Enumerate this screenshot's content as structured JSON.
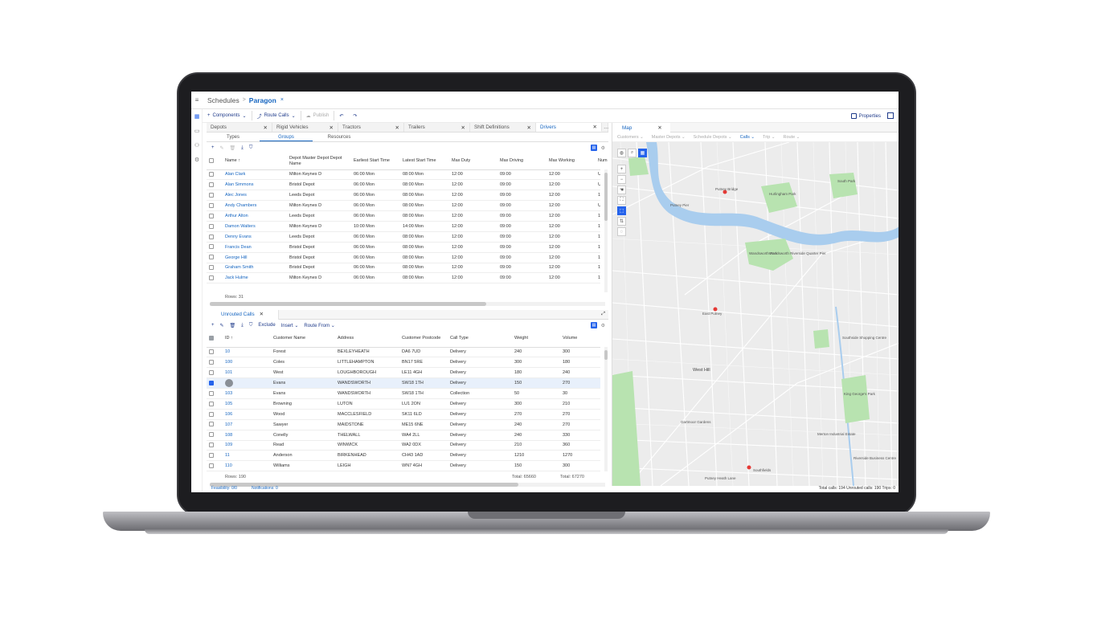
{
  "breadcrumb": {
    "root": "Schedules",
    "sep": ">",
    "current": "Paragon",
    "close": "×"
  },
  "toolbar": {
    "components": "Components",
    "route_calls": "Route Calls",
    "publish": "Publish",
    "properties": "Properties"
  },
  "tabs": [
    {
      "label": "Depots"
    },
    {
      "label": "Rigid Vehicles"
    },
    {
      "label": "Tractors"
    },
    {
      "label": "Trailers"
    },
    {
      "label": "Shift Definitions"
    },
    {
      "label": "Drivers"
    }
  ],
  "subtabs": [
    "Types",
    "Groups",
    "Resources"
  ],
  "drivers": {
    "columns": [
      "Name",
      "Depot Master Depot Depot Name",
      "Earliest Start Time",
      "Latest Start Time",
      "Max Duty",
      "Max Driving",
      "Max Working",
      "Num"
    ],
    "rows": [
      [
        "Alan Clark",
        "Milton Keynes D",
        "06:00 Mon",
        "08:00 Mon",
        "12:00",
        "09:00",
        "12:00",
        "U"
      ],
      [
        "Alan Simmons",
        "Bristol Depot",
        "06:00 Mon",
        "08:00 Mon",
        "12:00",
        "09:00",
        "12:00",
        "U"
      ],
      [
        "Alec Jones",
        "Leeds Depot",
        "06:00 Mon",
        "08:00 Mon",
        "12:00",
        "09:00",
        "12:00",
        "1"
      ],
      [
        "Andy Chambers",
        "Milton Keynes D",
        "06:00 Mon",
        "08:00 Mon",
        "12:00",
        "09:00",
        "12:00",
        "U"
      ],
      [
        "Arthur Alton",
        "Leeds Depot",
        "06:00 Mon",
        "08:00 Mon",
        "12:00",
        "09:00",
        "12:00",
        "1"
      ],
      [
        "Damon Walters",
        "Milton Keynes D",
        "10:00 Mon",
        "14:00 Mon",
        "12:00",
        "09:00",
        "12:00",
        "1"
      ],
      [
        "Denny Evans",
        "Leeds Depot",
        "06:00 Mon",
        "08:00 Mon",
        "12:00",
        "09:00",
        "12:00",
        "1"
      ],
      [
        "Francis Dean",
        "Bristol Depot",
        "06:00 Mon",
        "08:00 Mon",
        "12:00",
        "09:00",
        "12:00",
        "1"
      ],
      [
        "George Hill",
        "Bristol Depot",
        "06:00 Mon",
        "08:00 Mon",
        "12:00",
        "09:00",
        "12:00",
        "1"
      ],
      [
        "Graham Smith",
        "Bristol Depot",
        "06:00 Mon",
        "08:00 Mon",
        "12:00",
        "09:00",
        "12:00",
        "1"
      ],
      [
        "Jack Hulme",
        "Milton Keynes D",
        "06:00 Mon",
        "08:00 Mon",
        "12:00",
        "09:00",
        "12:00",
        "1"
      ]
    ],
    "rows_label": "Rows:  31"
  },
  "calls": {
    "tab": "Unrouted Calls",
    "toolbar": {
      "exclude": "Exclude",
      "insert": "Insert",
      "route_from": "Route From"
    },
    "columns": [
      "ID",
      "Customer Name",
      "Address",
      "Customer Postcode",
      "Call Type",
      "Weight",
      "Volume"
    ],
    "rows": [
      [
        "10",
        "Forest",
        "BEXLEYHEATH",
        "DA6 7UD",
        "Delivery",
        "240",
        "300"
      ],
      [
        "100",
        "Coles",
        "LITTLEHAMPTON",
        "BN17 5RE",
        "Delivery",
        "300",
        "180"
      ],
      [
        "101",
        "West",
        "LOUGHBOROUGH",
        "LE11 4GH",
        "Delivery",
        "180",
        "240"
      ],
      [
        "",
        "Evans",
        "WANDSWORTH",
        "SW18 1TH",
        "Delivery",
        "150",
        "270"
      ],
      [
        "103",
        "Evans",
        "WANDSWORTH",
        "SW18 1TH",
        "Collection",
        "50",
        "30"
      ],
      [
        "105",
        "Browning",
        "LUTON",
        "LU1 2ON",
        "Delivery",
        "300",
        "210"
      ],
      [
        "106",
        "Wood",
        "MACCLESFIELD",
        "SK11 6LD",
        "Delivery",
        "270",
        "270"
      ],
      [
        "107",
        "Sawyer",
        "MAIDSTONE",
        "ME15 6NE",
        "Delivery",
        "240",
        "270"
      ],
      [
        "108",
        "Conelly",
        "THELWALL",
        "WA4 2LL",
        "Delivery",
        "240",
        "330"
      ],
      [
        "109",
        "Read",
        "WINWICK",
        "WA2 0DX",
        "Delivery",
        "210",
        "360"
      ],
      [
        "11",
        "Anderson",
        "BIRKENHEAD",
        "CH43 1AD",
        "Delivery",
        "1210",
        "1270"
      ],
      [
        "110",
        "Williams",
        "LEIGH",
        "WN7 4GH",
        "Delivery",
        "150",
        "300"
      ]
    ],
    "rows_label": "Rows:  190",
    "total_weight": "Total:  65660",
    "total_volume": "Total:  67270"
  },
  "status": {
    "feasibility": "Feasibility: 0/0",
    "notifications": "Notifications: 0",
    "totals": "Total calls: 194   Unrouted calls: 190   Trips: 0"
  },
  "map": {
    "tab": "Map",
    "layers": [
      "Customers",
      "Master Depots",
      "Schedule Depots",
      "Calls",
      "Trip",
      "Route"
    ],
    "places": [
      "Putney Bridge",
      "Putney Pier",
      "East Putney",
      "Southfields",
      "Wandsworth Park",
      "Wandsworth Riverside Quarter Pier",
      "South Park",
      "Hurlingham Park",
      "Southside Shopping Centre",
      "King George's Park",
      "Merton Industrial Estate",
      "Riverside Business Centre",
      "West Hill",
      "Gartmoor Gardens",
      "Putney Heath Lane"
    ]
  },
  "colors": {
    "accent": "#1565c0",
    "river": "#a9cdee",
    "park": "#b8e3b0",
    "road": "#ffffff",
    "land": "#ececec"
  }
}
